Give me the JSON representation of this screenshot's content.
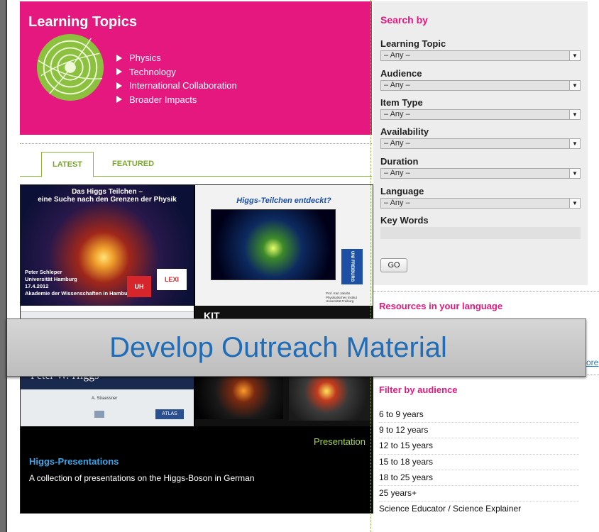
{
  "topics": {
    "title": "Learning Topics",
    "items": [
      "Physics",
      "Technology",
      "International Collaboration",
      "Broader Impacts"
    ]
  },
  "tabs": {
    "latest": "LATEST",
    "featured": "FEATURED"
  },
  "card": {
    "thumb1_title": "Das Higgs Teilchen –\neine Suche nach den Grenzen der Physik",
    "thumb1_name": "Peter Schleper\nUniversität Hamburg\n17.4.2012\nAkademie der Wissenschaften in Hamburg",
    "thumb1_logo1": "UH",
    "thumb1_logo2": "LEXI",
    "thumb2_title": "Higgs-Teilchen entdeckt?",
    "thumb2_uni": "UNI FREIBURG",
    "thumb2_credit": "Prof. Karl Jakobs\nPhysikalisches Institut\nUniversität Freiburg",
    "thumb3_name": "Peter W. Higgs",
    "thumb3_sub": "A. Straessner",
    "thumb3_logo": "ATLAS",
    "thumb4_logo": "KIT",
    "type_label": "Presentation",
    "title": "Higgs-Presentations",
    "description": "A collection of presentations on the Higgs-Boson in German"
  },
  "search": {
    "title": "Search by",
    "fields": [
      {
        "label": "Learning Topic",
        "value": "– Any –"
      },
      {
        "label": "Audience",
        "value": "– Any –"
      },
      {
        "label": "Item Type",
        "value": "– Any –"
      },
      {
        "label": "Availability",
        "value": "– Any –"
      },
      {
        "label": "Duration",
        "value": "– Any –"
      },
      {
        "label": "Language",
        "value": "– Any –"
      }
    ],
    "keywords_label": "Key Words",
    "keywords_value": "",
    "go_label": "GO",
    "select_arrow": "▼"
  },
  "language": {
    "title": "Resources in your language",
    "more_label": "ore"
  },
  "audience": {
    "title": "Filter by audience",
    "items": [
      "6 to 9 years",
      "9 to 12 years",
      "12 to 15 years",
      "15 to 18 years",
      "18 to 25 years",
      "25 years+",
      "Science Educator / Science Explainer"
    ]
  },
  "banner": {
    "text": "Develop Outreach Material"
  },
  "colors": {
    "magenta": "#e5187f",
    "green": "#8bb83a",
    "link_blue": "#1b7fc4",
    "banner_text": "#1f6db9"
  }
}
